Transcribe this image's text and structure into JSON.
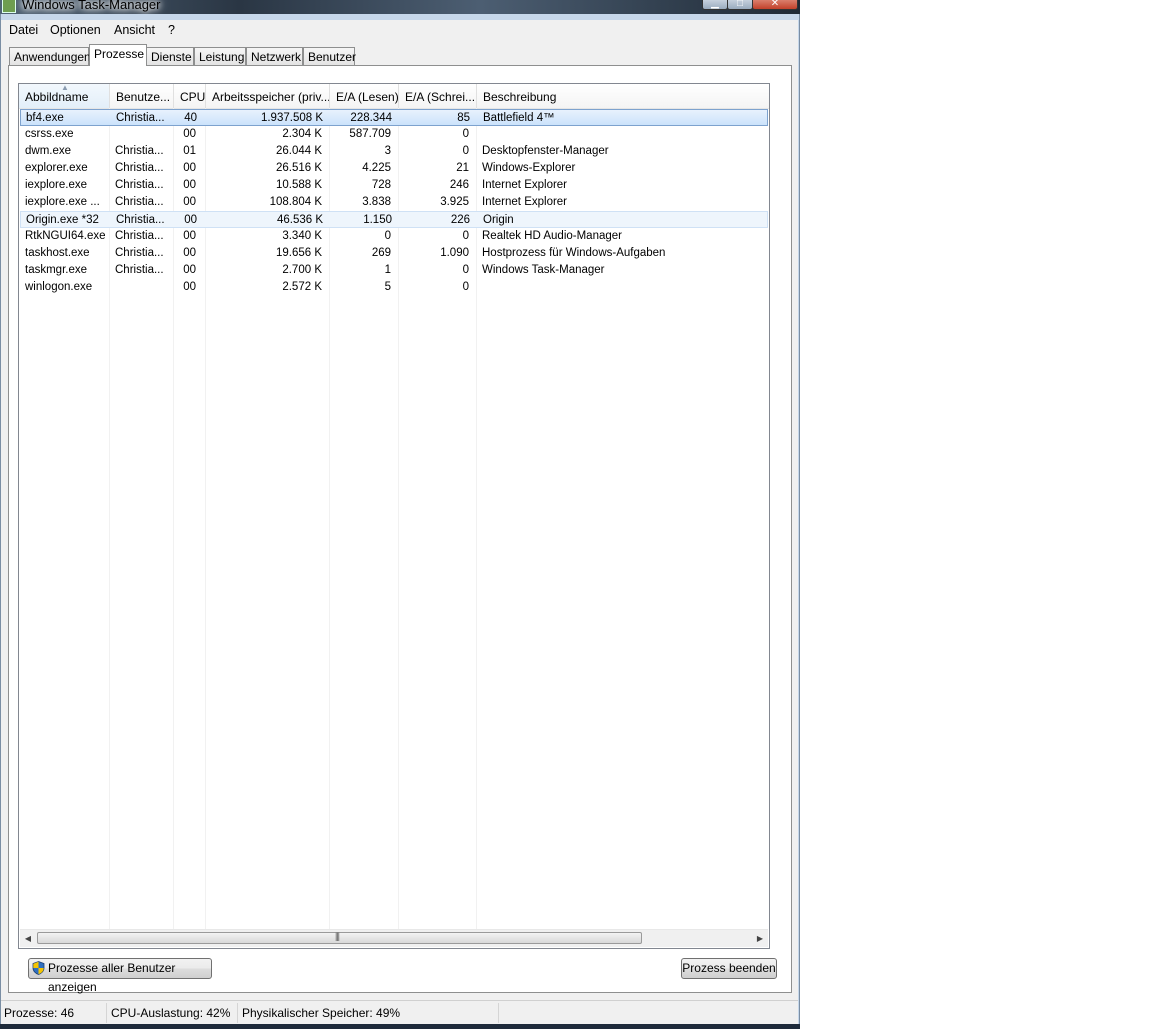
{
  "window": {
    "title": "Windows Task-Manager"
  },
  "menu": [
    "Datei",
    "Optionen",
    "Ansicht",
    "?"
  ],
  "tabs": [
    "Anwendungen",
    "Prozesse",
    "Dienste",
    "Leistung",
    "Netzwerk",
    "Benutzer"
  ],
  "active_tab": "Prozesse",
  "columns": [
    "Abbildname",
    "Benutze...",
    "CPU",
    "Arbeitsspeicher (priv...",
    "E/A (Lesen)",
    "E/A (Schrei...",
    "Beschreibung"
  ],
  "processes": [
    {
      "name": "bf4.exe",
      "user": "Christia...",
      "cpu": "40",
      "mem": "1.937.508 K",
      "io_read": "228.344",
      "io_write": "85",
      "desc": "Battlefield 4™"
    },
    {
      "name": "csrss.exe",
      "user": "",
      "cpu": "00",
      "mem": "2.304 K",
      "io_read": "587.709",
      "io_write": "0",
      "desc": ""
    },
    {
      "name": "dwm.exe",
      "user": "Christia...",
      "cpu": "01",
      "mem": "26.044 K",
      "io_read": "3",
      "io_write": "0",
      "desc": "Desktopfenster-Manager"
    },
    {
      "name": "explorer.exe",
      "user": "Christia...",
      "cpu": "00",
      "mem": "26.516 K",
      "io_read": "4.225",
      "io_write": "21",
      "desc": "Windows-Explorer"
    },
    {
      "name": "iexplore.exe",
      "user": "Christia...",
      "cpu": "00",
      "mem": "10.588 K",
      "io_read": "728",
      "io_write": "246",
      "desc": "Internet Explorer"
    },
    {
      "name": "iexplore.exe ...",
      "user": "Christia...",
      "cpu": "00",
      "mem": "108.804 K",
      "io_read": "3.838",
      "io_write": "3.925",
      "desc": "Internet Explorer"
    },
    {
      "name": "Origin.exe *32",
      "user": "Christia...",
      "cpu": "00",
      "mem": "46.536 K",
      "io_read": "1.150",
      "io_write": "226",
      "desc": "Origin"
    },
    {
      "name": "RtkNGUI64.exe",
      "user": "Christia...",
      "cpu": "00",
      "mem": "3.340 K",
      "io_read": "0",
      "io_write": "0",
      "desc": "Realtek HD Audio-Manager"
    },
    {
      "name": "taskhost.exe",
      "user": "Christia...",
      "cpu": "00",
      "mem": "19.656 K",
      "io_read": "269",
      "io_write": "1.090",
      "desc": "Hostprozess für Windows-Aufgaben"
    },
    {
      "name": "taskmgr.exe",
      "user": "Christia...",
      "cpu": "00",
      "mem": "2.700 K",
      "io_read": "1",
      "io_write": "0",
      "desc": "Windows Task-Manager"
    },
    {
      "name": "winlogon.exe",
      "user": "",
      "cpu": "00",
      "mem": "2.572 K",
      "io_read": "5",
      "io_write": "0",
      "desc": ""
    }
  ],
  "selected_row": 0,
  "highlighted_row": 6,
  "buttons": {
    "show_all": "Prozesse aller Benutzer anzeigen",
    "end_process": "Prozess beenden"
  },
  "status": {
    "processes": "Prozesse: 46",
    "cpu": "CPU-Auslastung: 42%",
    "memory": "Physikalischer Speicher: 49%"
  },
  "icons": {
    "shield": "uac-shield-icon"
  }
}
